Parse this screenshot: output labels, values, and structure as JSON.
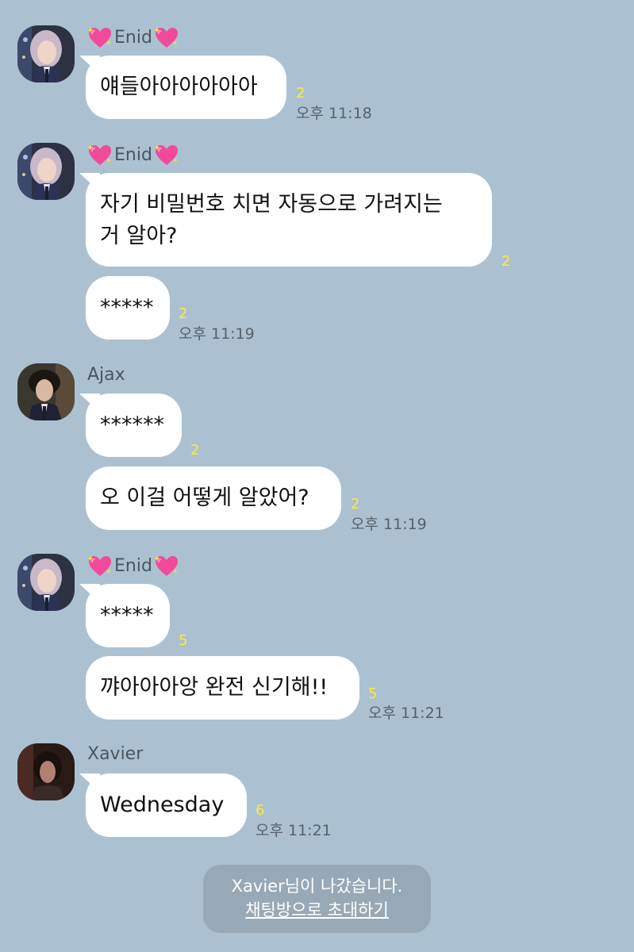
{
  "colors": {
    "background": "#abc1d1",
    "bubble": "#ffffff",
    "unread_count": "#ffe93a",
    "timestamp": "#56616b",
    "notice_bg": "#97a9b6"
  },
  "messages": [
    {
      "sender": "Enid",
      "sender_decoration": "sparkling-heart-emoji",
      "bubbles": [
        {
          "text": "얘들아아아아아아",
          "unread": "2",
          "time": "오후 11:18"
        }
      ]
    },
    {
      "sender": "Enid",
      "sender_decoration": "sparkling-heart-emoji",
      "bubbles": [
        {
          "text": "자기 비밀번호 치면 자동으로 가려지는\n거 알아?",
          "unread": "2",
          "time": ""
        },
        {
          "text": "*****",
          "unread": "2",
          "time": "오후 11:19"
        }
      ]
    },
    {
      "sender": "Ajax",
      "bubbles": [
        {
          "text": "******",
          "unread": "2",
          "time": ""
        },
        {
          "text": "오 이걸 어떻게 알았어?",
          "unread": "2",
          "time": "오후 11:19"
        }
      ]
    },
    {
      "sender": "Enid",
      "sender_decoration": "sparkling-heart-emoji",
      "bubbles": [
        {
          "text": "*****",
          "unread": "5",
          "time": ""
        },
        {
          "text": "꺄아아아앙 완전 신기해!!",
          "unread": "5",
          "time": "오후 11:21"
        }
      ]
    },
    {
      "sender": "Xavier",
      "bubbles": [
        {
          "text": "Wednesday",
          "unread": "6",
          "time": "오후 11:21"
        }
      ]
    }
  ],
  "notice": {
    "text": "Xavier님이 나갔습니다.",
    "link": "채팅방으로 초대하기"
  }
}
